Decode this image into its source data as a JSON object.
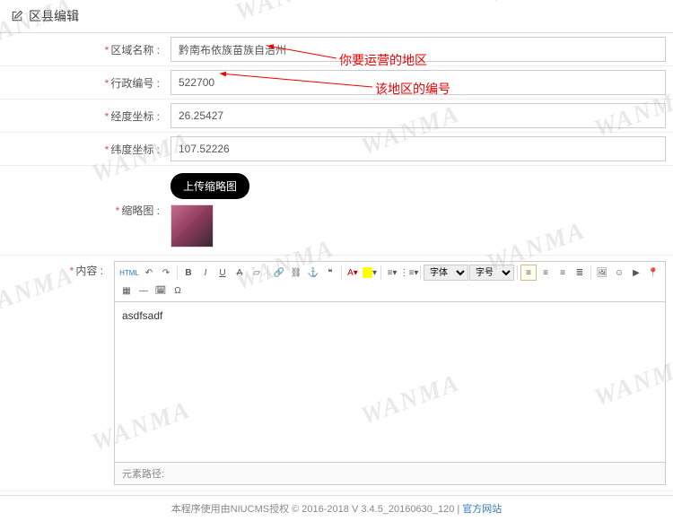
{
  "header": {
    "title": "区县编辑"
  },
  "form": {
    "fields": {
      "region_name": {
        "label": "区域名称",
        "value": "黔南布依族苗族自治州"
      },
      "admin_code": {
        "label": "行政编号",
        "value": "522700"
      },
      "longitude": {
        "label": "经度坐标",
        "value": "26.25427"
      },
      "latitude": {
        "label": "纬度坐标",
        "value": "107.52226"
      },
      "thumbnail": {
        "label": "缩略图",
        "upload_label": "上传缩略图"
      },
      "content": {
        "label": "内容",
        "value": "asdfsadf",
        "path_label": "元素路径:"
      }
    }
  },
  "editor": {
    "font_family_label": "字体",
    "font_size_label": "字号",
    "html_label": "HTML"
  },
  "annotations": {
    "region_note": "你要运营的地区",
    "code_note": "该地区的编号"
  },
  "footer": {
    "text": "本程序使用由NIUCMS授权 © 2016-2018 V 3.4.5_20160630_120 | ",
    "link_text": "官方网站"
  },
  "watermark": "WANMA"
}
